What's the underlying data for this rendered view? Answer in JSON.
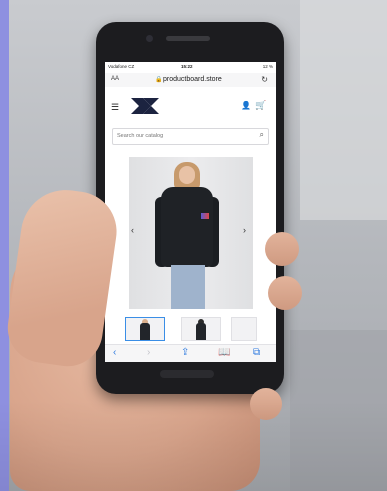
{
  "status_bar": {
    "carrier": "Vodafone CZ",
    "time": "15:22",
    "battery": "12 %"
  },
  "browser": {
    "aa_label": "AA",
    "url": "productboard.store",
    "bottom_icons": [
      "back-icon",
      "forward-icon",
      "share-icon",
      "bookmarks-icon",
      "tabs-icon"
    ]
  },
  "store": {
    "logo": "productboard-logo-icon",
    "search_placeholder": "Search our catalog"
  },
  "product": {
    "gallery_thumbnails": 3,
    "active_thumbnail": 1
  },
  "colors": {
    "phone_body": "#1c1c1f",
    "accent_blue": "#2f7be0",
    "hoodie": "#1f2226",
    "left_strip": "#8e90e0"
  }
}
